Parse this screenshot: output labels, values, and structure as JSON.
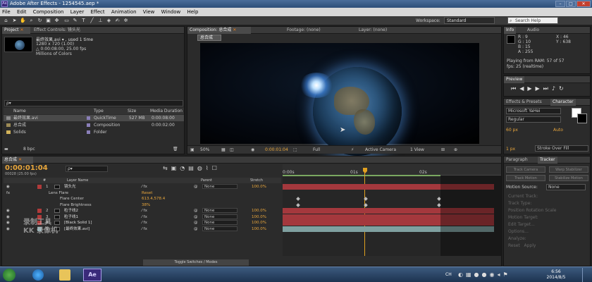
{
  "window": {
    "title": "Adobe After Effects - 1254545.aep *",
    "app_badge": "Ae"
  },
  "menu": [
    "File",
    "Edit",
    "Composition",
    "Layer",
    "Effect",
    "Animation",
    "View",
    "Window",
    "Help"
  ],
  "toolbar": {
    "workspace_label": "Workspace:",
    "workspace_value": "Standard",
    "search_placeholder": "Search Help"
  },
  "project_panel": {
    "tabs": [
      "Project",
      "Effect Controls: 镜头光"
    ],
    "preview_name": "最终效果.avi ▾ , used 1 time",
    "preview_info": [
      "1280 x 720 (1.00)",
      "△ 0:00:08:00, 25.00 fps",
      "Millions of Colors"
    ],
    "search_placeholder": "ρ▾",
    "columns": [
      "Name",
      "Type",
      "Size",
      "Media Duration"
    ],
    "items": [
      {
        "name": "最终效果.avi",
        "type": "QuickTime",
        "size": "527 MB",
        "duration": "0:00:08:00",
        "color": "#8a8a8a"
      },
      {
        "name": "总合成",
        "type": "Composition",
        "size": "",
        "duration": "0:00:02:00",
        "color": "#9c8a55"
      },
      {
        "name": "Solids",
        "type": "Folder",
        "size": "",
        "duration": "",
        "color": "#d2b35a"
      }
    ],
    "bpc": "8 bpc"
  },
  "comp_panel": {
    "tabs": [
      "Composition: 总合成",
      "Footage: (none)",
      "Layer: (none)"
    ],
    "comp_label": "总合成",
    "zoom": "50%",
    "timecode": "0:00:01:04",
    "resolution": "Full",
    "camera": "Active Camera",
    "view": "1 View"
  },
  "info_panel": {
    "tabs": [
      "Info",
      "Audio"
    ],
    "rgba": [
      "R : 9",
      "G : 10",
      "B : 15",
      "A : 255"
    ],
    "xy": [
      "X : 46",
      "Y : 638"
    ],
    "playing": [
      "Playing from RAM: 57 of 57",
      "fps: 25 (realtime)"
    ]
  },
  "preview_panel": {
    "title": "Preview"
  },
  "effects_panel": {
    "tabs": [
      "Effects & Presets",
      "Character"
    ],
    "font": "Microsoft YaHei",
    "style": "Regular",
    "size": "60 px",
    "tracking": "Auto",
    "stroke_size": "1 px",
    "stroke_mode": "Stroke Over Fill"
  },
  "tracker_panel": {
    "tabs": [
      "Paragraph",
      "Tracker"
    ],
    "motion_source_label": "Motion Source:",
    "motion_source_value": "None",
    "buttons": [
      "Track Camera",
      "Warp Stabilizer",
      "Track Motion",
      "Stabilize Motion"
    ],
    "fields": [
      "Current Track:",
      "Track Type:",
      "Position",
      "Rotation",
      "Scale",
      "Motion Target:",
      "Edit Target...",
      "Options...",
      "Analyze:",
      "Reset",
      "Apply"
    ]
  },
  "timeline": {
    "tab": "总合成",
    "timecode": "0:00:01:04",
    "frame_info": "00028 (25.00 fps)",
    "search_placeholder": "ρ▾",
    "columns": [
      "#",
      "Layer Name",
      "Parent",
      "Stretch"
    ],
    "ruler": [
      "0:00s",
      "01s",
      "02s"
    ],
    "toggle_label": "Toggle Switches / Modes",
    "layers": [
      {
        "num": "1",
        "name": "镜头光",
        "parent": "None",
        "stretch": "100.0%",
        "label_color": "#b03a3a",
        "kind": "layer"
      },
      {
        "num": "",
        "name": "Lens Flare",
        "parent": "",
        "stretch": "",
        "value": "Reset",
        "kind": "effect"
      },
      {
        "num": "",
        "name": "Flare Center",
        "parent": "",
        "stretch": "",
        "value": "613.4,578.4",
        "kind": "prop"
      },
      {
        "num": "",
        "name": "Flare Brightness",
        "parent": "",
        "stretch": "",
        "value": "38%",
        "kind": "prop"
      },
      {
        "num": "2",
        "name": "粒子线2",
        "parent": "None",
        "stretch": "100.0%",
        "label_color": "#b03a3a",
        "kind": "layer"
      },
      {
        "num": "3",
        "name": "粒子线1",
        "parent": "None",
        "stretch": "100.0%",
        "label_color": "#b03a3a",
        "kind": "layer"
      },
      {
        "num": "4",
        "name": "[Black Solid 1]",
        "parent": "None",
        "stretch": "100.0%",
        "label_color": "#b03a3a",
        "kind": "layer"
      },
      {
        "num": "5",
        "name": "[最终效果.avi]",
        "parent": "None",
        "stretch": "100.0%",
        "label_color": "#7a9aa0",
        "kind": "layer"
      }
    ]
  },
  "watermark": [
    "录制工具",
    "KK 录像机"
  ],
  "taskbar": {
    "time": "6:56",
    "date": "2014/8/5",
    "language": "CH"
  },
  "colors": {
    "accent_orange": "#e8a63c",
    "layer_red": "#a4383d",
    "layer_teal": "#7fa0a0",
    "playhead": "#e0a020"
  }
}
